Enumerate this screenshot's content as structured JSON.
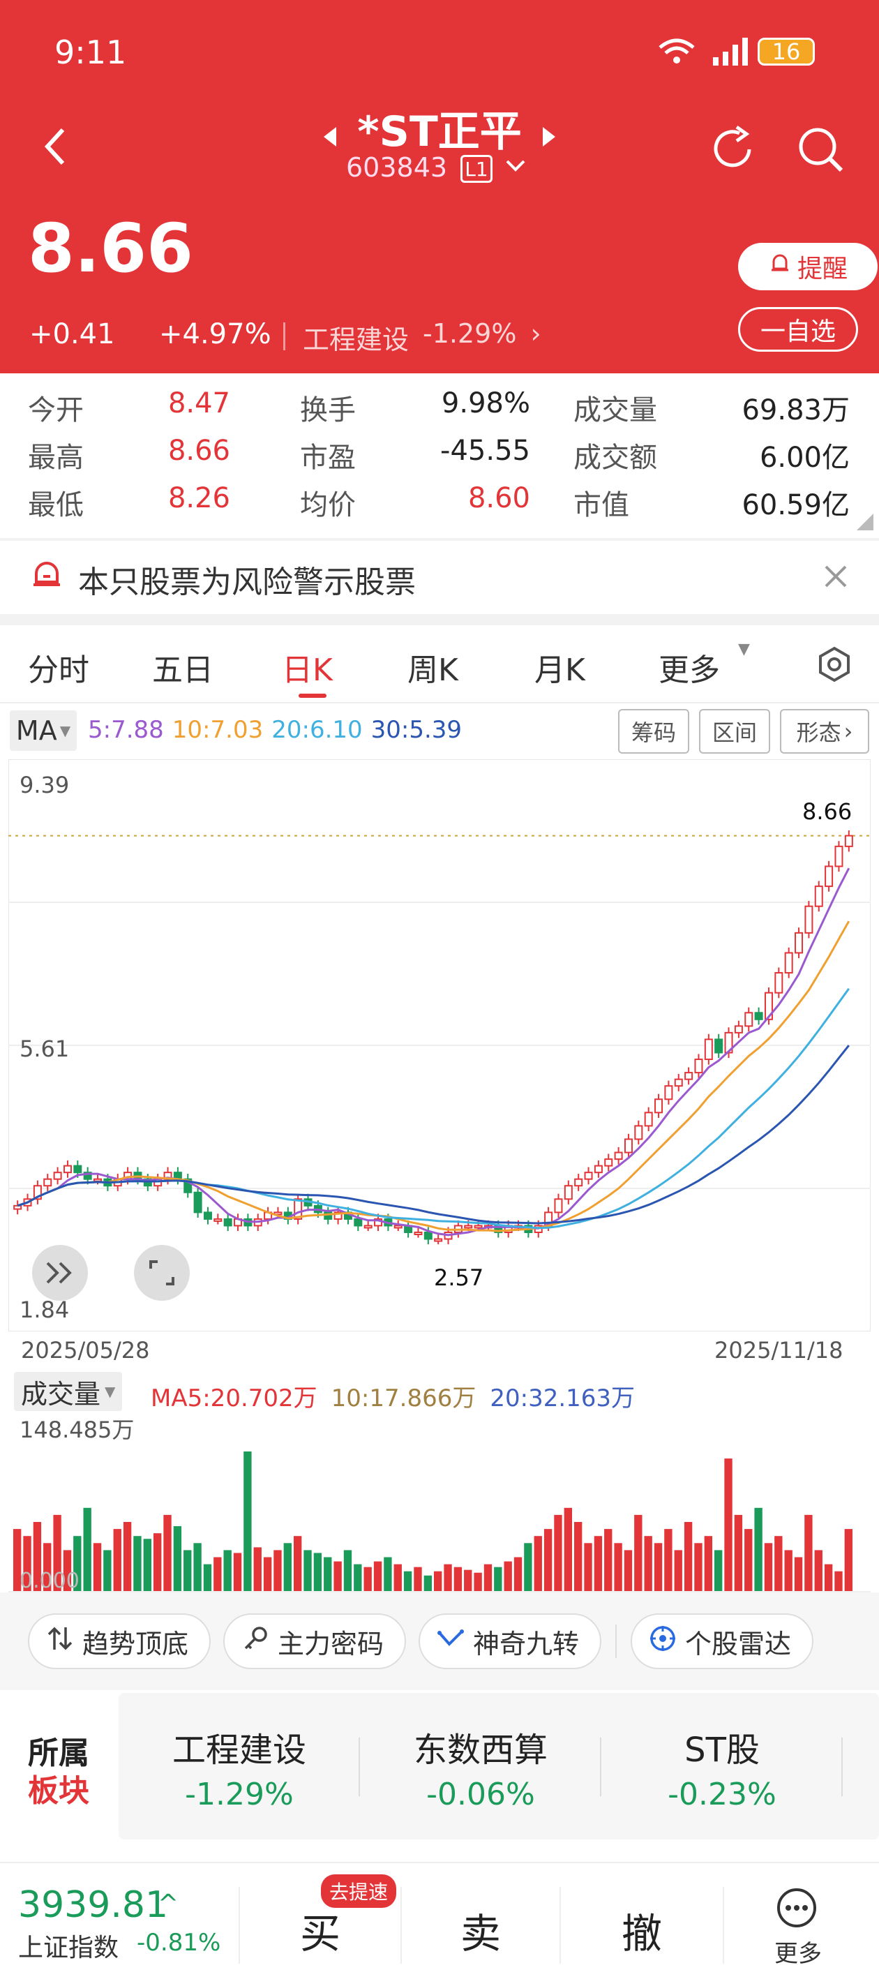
{
  "status_bar": {
    "time": "9:11",
    "battery": "16"
  },
  "stock": {
    "name": "*ST正平",
    "code": "603843",
    "level": "L1",
    "price": "8.66",
    "change": "+0.41",
    "change_pct": "+4.97%",
    "sector_name": "工程建设",
    "sector_change": "-1.29%",
    "remind_label": "提醒",
    "watchlist_label": "一自选"
  },
  "quote": {
    "rows": [
      [
        {
          "l": "今开",
          "v": "8.47"
        },
        {
          "l": "换手",
          "v": "9.98%"
        },
        {
          "l": "成交量",
          "v": "69.83万"
        }
      ],
      [
        {
          "l": "最高",
          "v": "8.66"
        },
        {
          "l": "市盈",
          "v": "-45.55"
        },
        {
          "l": "成交额",
          "v": "6.00亿"
        }
      ],
      [
        {
          "l": "最低",
          "v": "8.26"
        },
        {
          "l": "均价",
          "v": "8.60"
        },
        {
          "l": "市值",
          "v": "60.59亿"
        }
      ]
    ]
  },
  "warning": {
    "text": "本只股票为风险警示股票"
  },
  "tabs": {
    "items": [
      "分时",
      "五日",
      "日K",
      "周K",
      "月K",
      "更多"
    ],
    "active": "日K"
  },
  "ma_bar": {
    "label": "MA",
    "ma5": "5:7.88",
    "ma10": "10:7.03",
    "ma20": "20:6.10",
    "ma30": "30:5.39",
    "btn_chips": "筹码",
    "btn_range": "区间",
    "btn_pattern": "形态"
  },
  "chart_axis": {
    "y_top": "9.39",
    "y_mid": "5.61",
    "y_bot": "1.84",
    "last_price": "8.66",
    "low_label": "2.57",
    "date_start": "2025/05/28",
    "date_end": "2025/11/18"
  },
  "volume_bar": {
    "label": "成交量",
    "ma5": "MA5:20.702万",
    "ma10": "10:17.866万",
    "ma20": "20:32.163万",
    "max": "148.485万",
    "min": "0.000"
  },
  "tools": [
    "趋势顶底",
    "主力密码",
    "神奇九转",
    "个股雷达"
  ],
  "sectors": {
    "title_line1": "所属",
    "title_line2": "板块",
    "items": [
      {
        "name": "工程建设",
        "change": "-1.29%"
      },
      {
        "name": "东数西算",
        "change": "-0.06%"
      },
      {
        "name": "ST股",
        "change": "-0.23%"
      }
    ]
  },
  "bottom": {
    "index_value": "3939.81",
    "index_name": "上证指数",
    "index_change": "-0.81%",
    "buy": "买",
    "buy_badge": "去提速",
    "sell": "卖",
    "cancel": "撤",
    "more": "更多"
  },
  "colors": {
    "up": "#e33438",
    "down": "#1a9b5a",
    "ma5": "#9b59d0",
    "ma10": "#f0a030",
    "ma20": "#3fb0e0",
    "ma30": "#2a55b0"
  },
  "chart_data": {
    "type": "candlestick",
    "y_range": [
      1.84,
      9.39
    ],
    "x_range": [
      "2025/05/28",
      "2025/11/18"
    ],
    "last_close": 8.66,
    "period_low": 2.57,
    "close_trend": [
      3.1,
      3.2,
      3.4,
      3.5,
      3.6,
      3.7,
      3.6,
      3.5,
      3.5,
      3.4,
      3.5,
      3.6,
      3.5,
      3.4,
      3.5,
      3.6,
      3.5,
      3.3,
      3.0,
      2.9,
      2.9,
      2.8,
      2.9,
      2.8,
      2.9,
      3.0,
      3.0,
      2.9,
      3.2,
      3.1,
      3.0,
      2.9,
      3.0,
      2.9,
      2.8,
      2.8,
      2.9,
      2.8,
      2.8,
      2.7,
      2.7,
      2.6,
      2.6,
      2.7,
      2.8,
      2.8,
      2.8,
      2.8,
      2.7,
      2.8,
      2.8,
      2.7,
      2.8,
      3.0,
      3.2,
      3.4,
      3.5,
      3.6,
      3.7,
      3.8,
      3.9,
      4.1,
      4.3,
      4.5,
      4.7,
      4.9,
      5.0,
      5.1,
      5.3,
      5.6,
      5.4,
      5.7,
      5.8,
      6.0,
      5.9,
      6.3,
      6.6,
      6.9,
      7.2,
      7.6,
      7.9,
      8.2,
      8.5,
      8.66
    ],
    "volume_max": 148.485
  }
}
